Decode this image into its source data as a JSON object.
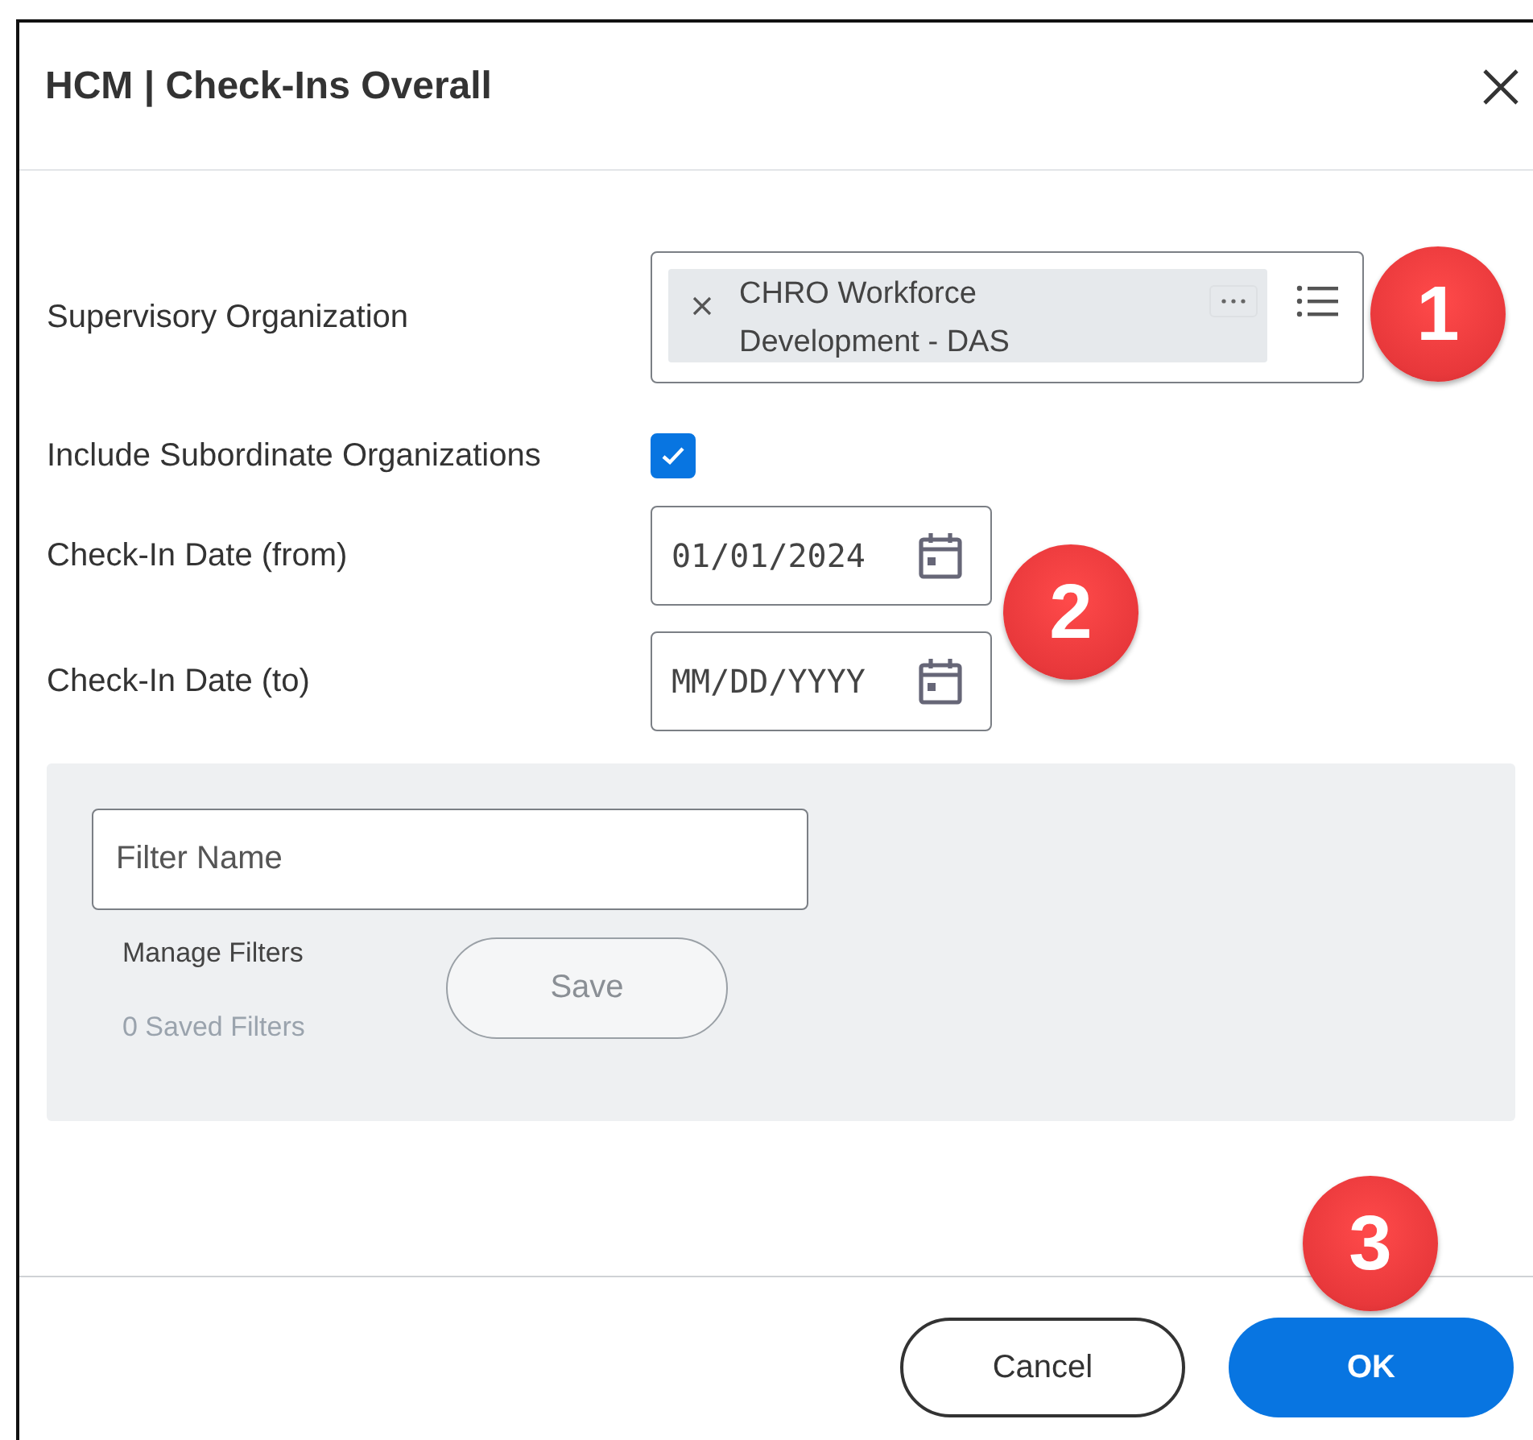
{
  "dialog": {
    "title": "HCM | Check-Ins Overall"
  },
  "fields": [
    {
      "kind": "prompt",
      "label": "Supervisory Organization",
      "chips": [
        {
          "text": "CHRO Workforce Development - DAS"
        }
      ]
    },
    {
      "kind": "checkbox",
      "label": "Include Subordinate Organizations",
      "checked": true
    },
    {
      "kind": "date",
      "label": "Check-In Date (from)",
      "value": "01/01/2024"
    },
    {
      "kind": "date",
      "label": "Check-In Date (to)",
      "placeholder": "MM/DD/YYYY"
    }
  ],
  "filter": {
    "placeholder": "Filter Name",
    "manage": "Manage Filters",
    "saved": "0 Saved Filters",
    "save_button": "Save"
  },
  "buttons": [
    {
      "label": "Cancel",
      "kind": "secondary"
    },
    {
      "label": "OK",
      "kind": "primary"
    }
  ],
  "callouts": [
    "1",
    "2",
    "3"
  ]
}
